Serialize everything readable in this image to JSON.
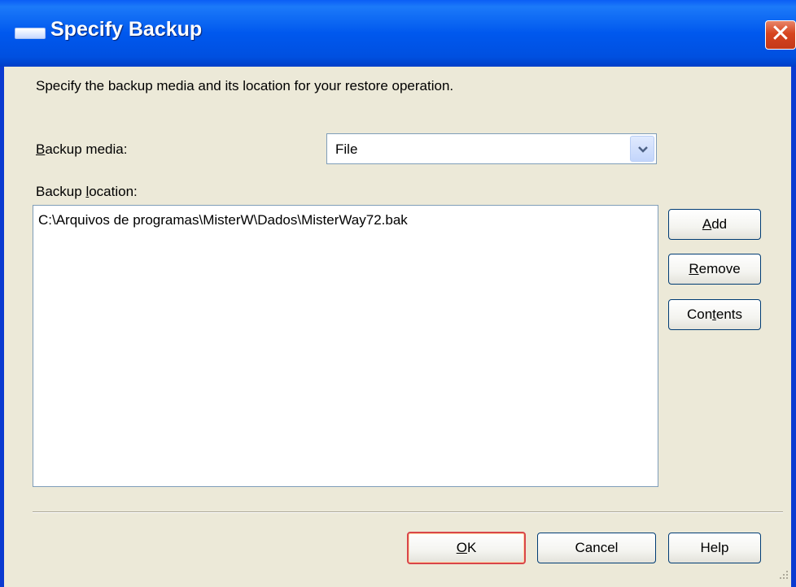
{
  "window": {
    "title": "Specify Backup",
    "close_glyph": "✕"
  },
  "description": "Specify the backup media and its location for your restore operation.",
  "backup_media": {
    "label_mnemonic": "B",
    "label_rest": "ackup media:",
    "value": "File"
  },
  "backup_location": {
    "label_pre": "Backup ",
    "label_mnemonic": "l",
    "label_rest": "ocation:",
    "items": [
      "C:\\Arquivos de programas\\MisterW\\Dados\\MisterWay72.bak"
    ]
  },
  "side_buttons": {
    "add_mnemonic": "A",
    "add_rest": "dd",
    "remove_mnemonic": "R",
    "remove_rest": "emove",
    "contents_pre": "Con",
    "contents_mnemonic": "t",
    "contents_rest": "ents"
  },
  "footer_buttons": {
    "ok_mnemonic": "O",
    "ok_rest": "K",
    "cancel": "Cancel",
    "help": "Help"
  },
  "icons": {
    "window": "window-icon",
    "close": "close-icon",
    "dropdown": "chevron-down-icon",
    "grip": "resize-grip-icon"
  },
  "colors": {
    "titlebar": "#0058ee",
    "dialog_bg": "#ece9d8",
    "close_button": "#d6441e",
    "default_button_border": "#d9464a"
  }
}
